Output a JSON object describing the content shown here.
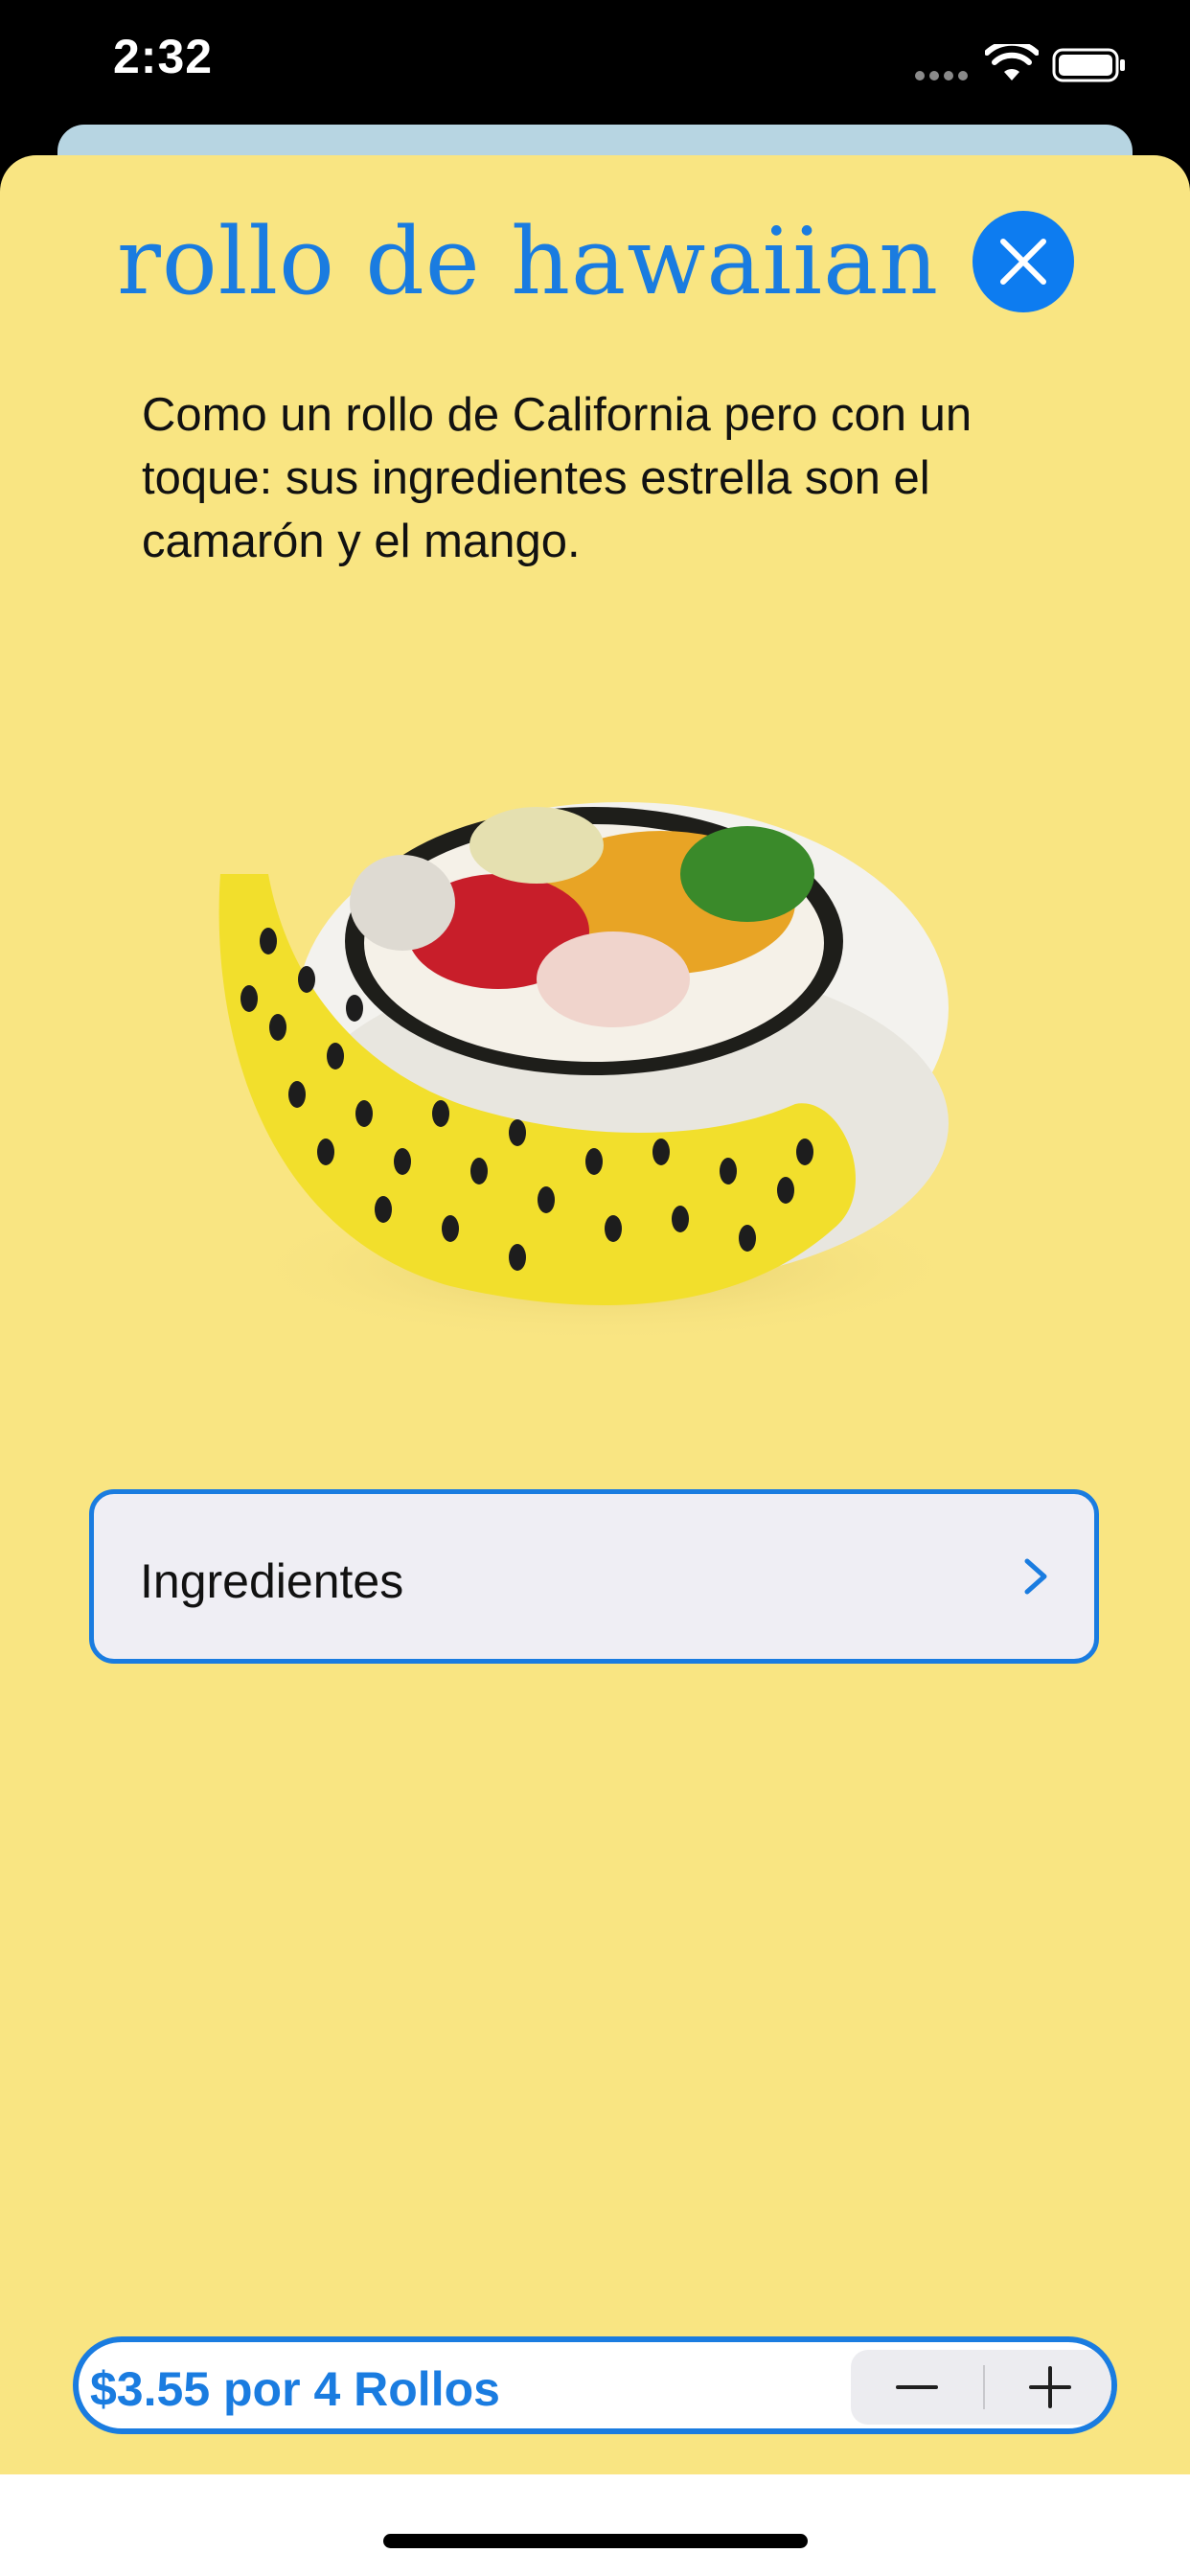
{
  "status_bar": {
    "time": "2:32"
  },
  "sheet": {
    "title": "rollo de hawaiian",
    "description": "Como un rollo de California pero con un toque: sus ingredientes estrella son el camarón y el mango.",
    "ingredients_label": "Ingredientes"
  },
  "order": {
    "price_label": "$3.55 por 4 Rollos"
  },
  "colors": {
    "sheet_background": "#f9e582",
    "accent": "#1a7ce0",
    "close_button": "#0d7cf0",
    "back_card": "#b7d5e2"
  },
  "icons": {
    "close": "close-icon",
    "chevron": "chevron-right-icon",
    "minus": "minus-icon",
    "plus": "plus-icon"
  }
}
